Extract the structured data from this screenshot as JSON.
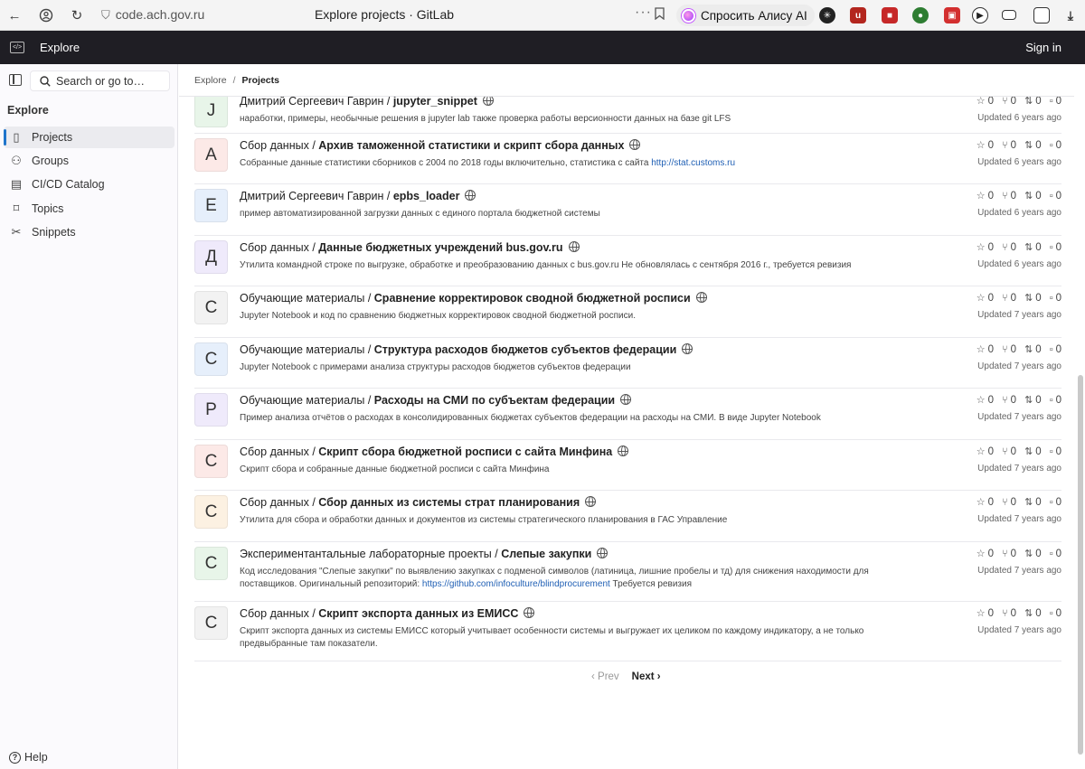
{
  "browser": {
    "url": "code.ach.gov.ru",
    "tab_title": "Explore projects · GitLab",
    "alice_label": "Спросить Алису AI",
    "more_dots": "···"
  },
  "topnav": {
    "title": "Explore",
    "signin": "Sign in"
  },
  "sidebar": {
    "search_placeholder": "Search or go to…",
    "heading": "Explore",
    "items": [
      {
        "label": "Projects",
        "icon": "project-icon"
      },
      {
        "label": "Groups",
        "icon": "group-icon"
      },
      {
        "label": "CI/CD Catalog",
        "icon": "catalog-icon"
      },
      {
        "label": "Topics",
        "icon": "tag-icon"
      },
      {
        "label": "Snippets",
        "icon": "snippet-icon"
      }
    ],
    "help": "Help"
  },
  "breadcrumb": {
    "root": "Explore",
    "current": "Projects"
  },
  "projects": [
    {
      "letter": "J",
      "ns": "Дмитрий Сергеевич Гаврин / ",
      "name": "jupyter_snippet",
      "desc": "наработки, примеры, необычные решения в jupyter lab также проверка работы версионности данных на базе git LFS",
      "stars": "0",
      "forks": "0",
      "mrs": "0",
      "issues": "0",
      "updated": "Updated 6 years ago",
      "color": "#e8f5e9"
    },
    {
      "letter": "A",
      "ns": "Сбор данных / ",
      "name": "Архив таможенной статистики и скрипт сбора данных",
      "desc": "Собранные данные статистики сборников с 2004 по 2018 годы включительно, статистика с сайта ",
      "link": "http://stat.customs.ru",
      "stars": "0",
      "forks": "0",
      "mrs": "0",
      "issues": "0",
      "updated": "Updated 6 years ago",
      "color": "#fce9e7"
    },
    {
      "letter": "E",
      "ns": "Дмитрий Сергеевич Гаврин / ",
      "name": "epbs_loader",
      "desc": "пример автоматизированной загрузки данных с единого портала бюджетной системы",
      "stars": "0",
      "forks": "0",
      "mrs": "0",
      "issues": "0",
      "updated": "Updated 6 years ago",
      "color": "#e6effb"
    },
    {
      "letter": "Д",
      "ns": "Сбор данных / ",
      "name": "Данные бюджетных учреждений bus.gov.ru",
      "desc": "Утилита командной строке по выгрузке, обработке и преобразованию данных с bus.gov.ru Не обновлялась с сентября 2016 г., требуется ревизия",
      "stars": "0",
      "forks": "0",
      "mrs": "0",
      "issues": "0",
      "updated": "Updated 6 years ago",
      "color": "#efeafb"
    },
    {
      "letter": "С",
      "ns": "Обучающие материалы / ",
      "name": "Сравнение корректировок сводной бюджетной росписи",
      "desc": "Jupyter Notebook и код по сравнению бюджетных корректировок сводной бюджетной росписи.",
      "stars": "0",
      "forks": "0",
      "mrs": "0",
      "issues": "0",
      "updated": "Updated 7 years ago",
      "color": "#f2f2f2"
    },
    {
      "letter": "С",
      "ns": "Обучающие материалы / ",
      "name": "Структура расходов бюджетов субъектов федерации",
      "desc": "Jupyter Notebook с примерами анализа структуры расходов бюджетов субъектов федерации",
      "stars": "0",
      "forks": "0",
      "mrs": "0",
      "issues": "0",
      "updated": "Updated 7 years ago",
      "color": "#e6effb"
    },
    {
      "letter": "Р",
      "ns": "Обучающие материалы / ",
      "name": "Расходы на СМИ по субъектам федерации",
      "desc": "Пример анализа отчётов о расходах в консолидированных бюджетах субъектов федерации на расходы на СМИ. В виде Jupyter Notebook",
      "stars": "0",
      "forks": "0",
      "mrs": "0",
      "issues": "0",
      "updated": "Updated 7 years ago",
      "color": "#efeafb"
    },
    {
      "letter": "С",
      "ns": "Сбор данных / ",
      "name": "Скрипт сбора бюджетной росписи с сайта Минфина",
      "desc": "Скрипт сбора и собранные данные бюджетной росписи с сайта Минфина",
      "stars": "0",
      "forks": "0",
      "mrs": "0",
      "issues": "0",
      "updated": "Updated 7 years ago",
      "color": "#fce9e7"
    },
    {
      "letter": "С",
      "ns": "Сбор данных / ",
      "name": "Сбор данных из системы страт планирования",
      "desc": "Утилита для сбора и обработки данных и документов из системы стратегического планирования в ГАС Управление",
      "stars": "0",
      "forks": "0",
      "mrs": "0",
      "issues": "0",
      "updated": "Updated 7 years ago",
      "color": "#fcf1e2"
    },
    {
      "letter": "С",
      "ns": "Экспериментантальные лабораторные проекты / ",
      "name": "Слепые закупки",
      "desc": "Код исследования \"Слепые закупки\" по выявлению закупках с подменой символов (латиница, лишние пробелы и тд) для снижения находимости для поставщиков. Оригинальный репозиторий: ",
      "link": "https://github.com/infoculture/blindprocurement",
      "desc_tail": " Требуется ревизия",
      "stars": "0",
      "forks": "0",
      "mrs": "0",
      "issues": "0",
      "updated": "Updated 7 years ago",
      "color": "#e8f5e9"
    },
    {
      "letter": "С",
      "ns": "Сбор данных / ",
      "name": "Скрипт экспорта данных из ЕМИСС",
      "desc": "Скрипт экспорта данных из системы ЕМИСС который учитывает особенности системы и выгружает их целиком по каждому индикатору, а не только предвыбранные там показатели.",
      "stars": "0",
      "forks": "0",
      "mrs": "0",
      "issues": "0",
      "updated": "Updated 7 years ago",
      "color": "#f2f2f2"
    }
  ],
  "pager": {
    "prev": "‹ Prev",
    "next": "Next ›"
  }
}
